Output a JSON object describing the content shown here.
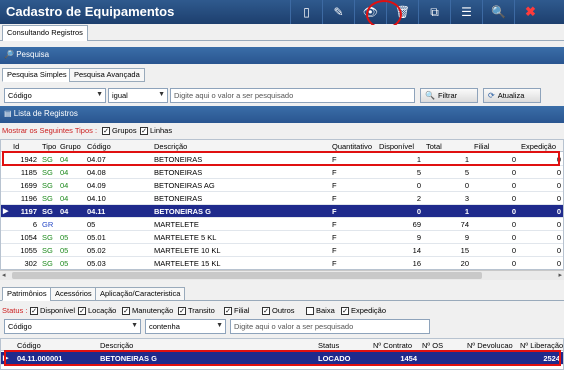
{
  "app": {
    "title": "Cadastro de Equipamentos"
  },
  "toolbar": {
    "icons": [
      "document-icon",
      "pencil-icon",
      "view-icon",
      "trash-icon",
      "copy-icon",
      "menu-icon",
      "search-icon",
      "close-icon"
    ]
  },
  "main_tab": {
    "label": "Consultando Registros"
  },
  "search_section": {
    "title": "Pesquisa",
    "tabs": [
      "Pesquisa Simples",
      "Pesquisa Avançada"
    ],
    "field_value": "Código",
    "operator_value": "igual",
    "placeholder": "Digite aqui o valor a ser pesquisado",
    "filter_button": "Filtrar",
    "refresh_button": "Atualiza"
  },
  "list_section": {
    "title": "Lista de Registros",
    "show_types_label": "Mostrar os Seguintes Tipos :",
    "check_groups": "Grupos",
    "check_lines": "Linhas",
    "columns": [
      "Id",
      "Tipo",
      "Grupo",
      "Código",
      "Descrição",
      "Quantitativo",
      "Disponível",
      "Total",
      "Filial",
      "Expedição"
    ],
    "rows": [
      {
        "id": "1942",
        "tipo": "SG",
        "grupo": "04",
        "codigo": "04.07",
        "descricao": "BETONEIRAS",
        "quant": "F",
        "disp": "1",
        "total": "1",
        "filial": "0",
        "exp": "0"
      },
      {
        "id": "1185",
        "tipo": "SG",
        "grupo": "04",
        "codigo": "04.08",
        "descricao": "BETONEIRAS",
        "quant": "F",
        "disp": "5",
        "total": "5",
        "filial": "0",
        "exp": "0"
      },
      {
        "id": "1699",
        "tipo": "SG",
        "grupo": "04",
        "codigo": "04.09",
        "descricao": "BETONEIRAS AG",
        "quant": "F",
        "disp": "0",
        "total": "0",
        "filial": "0",
        "exp": "0"
      },
      {
        "id": "1196",
        "tipo": "SG",
        "grupo": "04",
        "codigo": "04.10",
        "descricao": "BETONEIRAS",
        "quant": "F",
        "disp": "2",
        "total": "3",
        "filial": "0",
        "exp": "0"
      },
      {
        "id": "1197",
        "tipo": "SG",
        "grupo": "04",
        "codigo": "04.11",
        "descricao": "BETONEIRAS G",
        "quant": "F",
        "disp": "0",
        "total": "1",
        "filial": "0",
        "exp": "0"
      },
      {
        "id": "6",
        "tipo": "GR",
        "grupo": "",
        "codigo": "05",
        "descricao": "MARTELETE",
        "quant": "F",
        "disp": "69",
        "total": "74",
        "filial": "0",
        "exp": "0"
      },
      {
        "id": "1054",
        "tipo": "SG",
        "grupo": "05",
        "codigo": "05.01",
        "descricao": "MARTELETE 5 KL",
        "quant": "F",
        "disp": "9",
        "total": "9",
        "filial": "0",
        "exp": "0"
      },
      {
        "id": "1055",
        "tipo": "SG",
        "grupo": "05",
        "codigo": "05.02",
        "descricao": "MARTELETE 10 KL",
        "quant": "F",
        "disp": "14",
        "total": "15",
        "filial": "0",
        "exp": "0"
      },
      {
        "id": "302",
        "tipo": "SG",
        "grupo": "05",
        "codigo": "05.03",
        "descricao": "MARTELETE 15 KL",
        "quant": "F",
        "disp": "16",
        "total": "20",
        "filial": "0",
        "exp": "0"
      }
    ]
  },
  "detail_section": {
    "tabs": [
      "Patrimônios",
      "Acessórios",
      "Aplicação/Caracteristica"
    ],
    "status_label": "Status :",
    "status_checks": [
      "Disponível",
      "Locação",
      "Manutenção",
      "Transito",
      "Filial",
      "Outros",
      "Baixa",
      "Expedição"
    ],
    "status_checked": [
      true,
      true,
      true,
      true,
      true,
      true,
      false,
      true
    ],
    "field_value": "Código",
    "operator_value": "contenha",
    "placeholder": "Digite aqui o valor a ser pesquisado",
    "columns": [
      "Código",
      "Descrição",
      "Status",
      "Nº Contrato",
      "Nº OS",
      "Nº Devolucao",
      "Nº Liberação"
    ],
    "rows": [
      {
        "codigo": "04.11.000001",
        "descricao": "BETONEIRAS G",
        "status": "LOCADO",
        "contrato": "1454",
        "os": "",
        "devolucao": "",
        "liberacao": "2524"
      }
    ]
  }
}
